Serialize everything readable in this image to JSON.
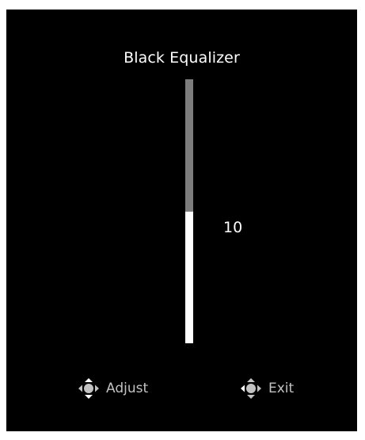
{
  "osd": {
    "title": "Black Equalizer",
    "slider": {
      "value": "10",
      "min": 0,
      "max": 20,
      "level_fraction": 0.5
    },
    "hints": {
      "adjust": {
        "icon": "joystick-up-down-icon",
        "label": "Adjust"
      },
      "exit": {
        "icon": "joystick-left-icon",
        "label": "Exit"
      }
    },
    "colors": {
      "background": "#000000",
      "text": "#ffffff",
      "hint_text": "#c2c2c2",
      "slider_track": "#7d7d7d",
      "slider_fill": "#ffffff"
    }
  }
}
